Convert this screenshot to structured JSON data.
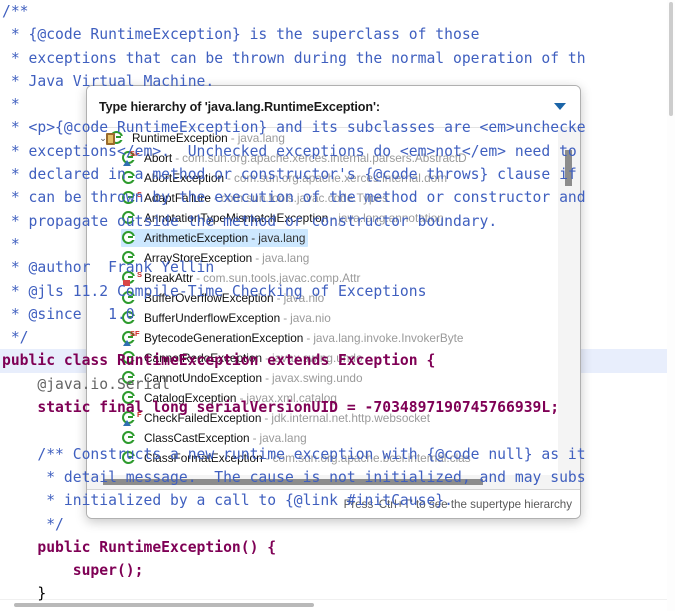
{
  "editor": {
    "lines": [
      {
        "text": "/**",
        "cls": "cm",
        "hl": false
      },
      {
        "text": " * {@code RuntimeException} is the superclass of those",
        "cls": "cm",
        "hl": false
      },
      {
        "text": " * exceptions that can be thrown during the normal operation of th",
        "cls": "cm",
        "hl": false
      },
      {
        "text": " * Java Virtual Machine.",
        "cls": "cm",
        "hl": false
      },
      {
        "text": " *",
        "cls": "cm",
        "hl": false
      },
      {
        "text": " * <p>{@code RuntimeException} and its subclasses are <em>unchecke",
        "cls": "cm",
        "hl": false
      },
      {
        "text": " * exceptions</em>.  Unchecked exceptions do <em>not</em> need to",
        "cls": "cm",
        "hl": false
      },
      {
        "text": " * declared in a method or constructor's {@code throws} clause if",
        "cls": "cm",
        "hl": false
      },
      {
        "text": " * can be thrown by the execution of the method or constructor and",
        "cls": "cm",
        "hl": false
      },
      {
        "text": " * propagate outside the method or constructor boundary.",
        "cls": "cm",
        "hl": false
      },
      {
        "text": " *",
        "cls": "cm",
        "hl": false
      },
      {
        "text": " * @author  Frank Yellin",
        "cls": "cm",
        "hl": false
      },
      {
        "text": " * @jls 11.2 Compile-Time Checking of Exceptions",
        "cls": "cm",
        "hl": false
      },
      {
        "text": " * @since   1.0",
        "cls": "cm",
        "hl": false
      },
      {
        "text": " */",
        "cls": "cm",
        "hl": false
      },
      {
        "text": "public class RuntimeException extends Exception {",
        "cls": "kw",
        "hl": true
      },
      {
        "text": "    @java.io.Serial",
        "cls": "ann",
        "hl": false
      },
      {
        "text": "    static final long serialVersionUID = -7034897190745766939L;",
        "cls": "kw",
        "hl": false
      },
      {
        "text": "",
        "cls": "plain",
        "hl": false
      },
      {
        "text": "    /** Constructs a new runtime exception with {@code null} as it",
        "cls": "cm",
        "hl": false
      },
      {
        "text": "     * detail message.  The cause is not initialized, and may subs",
        "cls": "cm",
        "hl": false
      },
      {
        "text": "     * initialized by a call to {@link #initCause}.",
        "cls": "cm",
        "hl": false
      },
      {
        "text": "     */",
        "cls": "cm",
        "hl": false
      },
      {
        "text": "    public RuntimeException() {",
        "cls": "kw",
        "hl": false
      },
      {
        "text": "        super();",
        "cls": "kw",
        "hl": false
      },
      {
        "text": "    }",
        "cls": "plain",
        "hl": false
      }
    ]
  },
  "popup": {
    "title": "Type hierarchy of 'java.lang.RuntimeException':",
    "dropdown_icon": "chevron-down-icon",
    "footer_hint": "Press 'Ctrl+T' to see the supertype hierarchy",
    "items": [
      {
        "name": "RuntimeException",
        "pkg": "java.lang",
        "depth": 0,
        "twisty": "⌄",
        "icon": "class-icon",
        "markers": [],
        "selected": false
      },
      {
        "name": "Abort",
        "pkg": "com.sun.org.apache.xerces.internal.parsers.AbstractD",
        "depth": 1,
        "twisty": "",
        "icon": "class-icon-protected-static-final",
        "markers": [
          "S",
          "F"
        ],
        "overlay": "tri",
        "selected": false
      },
      {
        "name": "AbortException",
        "pkg": "com.sun.org.apache.xerces.internal.dom",
        "depth": 1,
        "twisty": "",
        "icon": "class-icon",
        "markers": [],
        "selected": false
      },
      {
        "name": "AdaptFailure",
        "pkg": "com.sun.tools.javac.code.Types",
        "depth": 1,
        "twisty": "",
        "icon": "class-icon-static",
        "markers": [
          "S"
        ],
        "selected": false
      },
      {
        "name": "AnnotationTypeMismatchException",
        "pkg": "java.lang.annotation",
        "depth": 1,
        "twisty": "",
        "icon": "class-icon",
        "markers": [],
        "selected": false
      },
      {
        "name": "ArithmeticException",
        "pkg": "java.lang",
        "depth": 1,
        "twisty": "",
        "icon": "class-icon",
        "markers": [],
        "selected": true
      },
      {
        "name": "ArrayStoreException",
        "pkg": "java.lang",
        "depth": 1,
        "twisty": "",
        "icon": "class-icon",
        "markers": [],
        "selected": false
      },
      {
        "name": "BreakAttr",
        "pkg": "com.sun.tools.javac.comp.Attr",
        "depth": 1,
        "twisty": "",
        "icon": "class-icon-private-static",
        "markers": [
          "S"
        ],
        "overlay": "sq",
        "selected": false
      },
      {
        "name": "BufferOverflowException",
        "pkg": "java.nio",
        "depth": 1,
        "twisty": "",
        "icon": "class-icon",
        "markers": [],
        "selected": false
      },
      {
        "name": "BufferUnderflowException",
        "pkg": "java.nio",
        "depth": 1,
        "twisty": "",
        "icon": "class-icon",
        "markers": [],
        "selected": false
      },
      {
        "name": "BytecodeGenerationException",
        "pkg": "java.lang.invoke.InvokerByte",
        "depth": 1,
        "twisty": "",
        "icon": "class-icon-protected-static-final",
        "markers": [
          "S",
          "F"
        ],
        "overlay": "tri",
        "selected": false
      },
      {
        "name": "CannotRedoException",
        "pkg": "javax.swing.undo",
        "depth": 1,
        "twisty": "",
        "icon": "class-icon",
        "markers": [],
        "selected": false
      },
      {
        "name": "CannotUndoException",
        "pkg": "javax.swing.undo",
        "depth": 1,
        "twisty": "",
        "icon": "class-icon",
        "markers": [],
        "selected": false
      },
      {
        "name": "CatalogException",
        "pkg": "javax.xml.catalog",
        "depth": 1,
        "twisty": "",
        "icon": "class-icon",
        "markers": [],
        "selected": false
      },
      {
        "name": "CheckFailedException",
        "pkg": "jdk.internal.net.http.websocket",
        "depth": 1,
        "twisty": "",
        "icon": "class-icon-protected-final",
        "markers": [
          "F"
        ],
        "overlay": "tri",
        "selected": false
      },
      {
        "name": "ClassCastException",
        "pkg": "java.lang",
        "depth": 1,
        "twisty": "",
        "icon": "class-icon",
        "markers": [],
        "selected": false
      },
      {
        "name": "ClassFormatException",
        "pkg": "com.sun.org.apache.bcel.internal.clas",
        "depth": 1,
        "twisty": "",
        "icon": "class-icon",
        "markers": [],
        "selected": false
      }
    ]
  }
}
